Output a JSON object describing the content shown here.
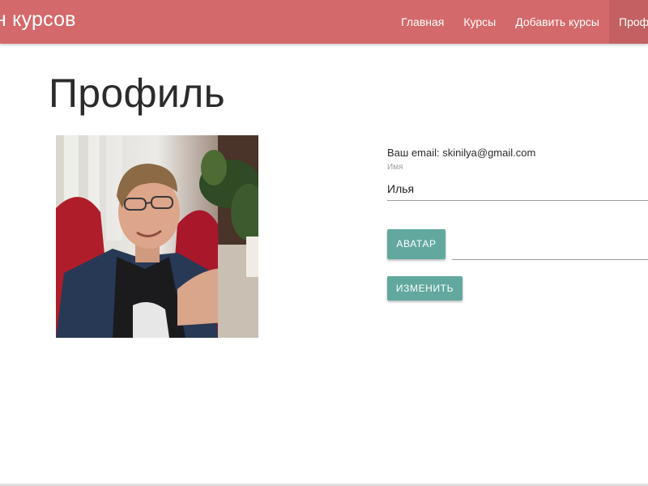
{
  "navbar": {
    "brand": "н курсов",
    "links": [
      {
        "label": "Главная"
      },
      {
        "label": "Курсы"
      },
      {
        "label": "Добавить курсы"
      },
      {
        "label": "Профиль",
        "active": true
      }
    ],
    "color": "#d4696b"
  },
  "page": {
    "title": "Профиль"
  },
  "profile": {
    "email_prefix": "Ваш email:",
    "email": "skinilya@gmail.com",
    "name_label": "Имя",
    "name_value": "Илья",
    "avatar_button": "Аватар",
    "submit_button": "Изменить",
    "button_color": "#62a89f"
  }
}
